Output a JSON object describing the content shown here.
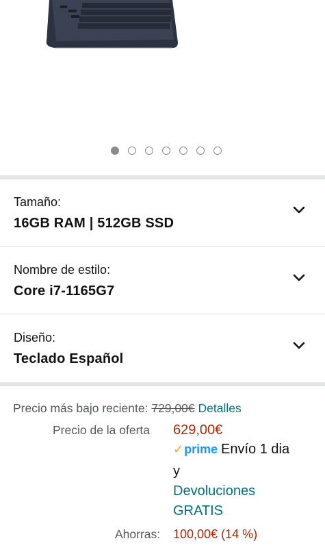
{
  "carousel": {
    "dot_count": 7,
    "active_index": 0
  },
  "variations": [
    {
      "label": "Tamaño:",
      "value": "16GB RAM | 512GB SSD"
    },
    {
      "label": "Nombre de estilo:",
      "value": "Core i7-1165G7"
    },
    {
      "label": "Diseño:",
      "value": "Teclado Español"
    }
  ],
  "pricing": {
    "recent_low_label": "Precio más bajo reciente:",
    "recent_low_value": "729,00€",
    "details_link": "Detalles",
    "offer_label": "Precio de la oferta",
    "offer_value": "629,00€",
    "prime_logo": "prime",
    "shipping_text": "Envío 1 dia",
    "and_text": "y",
    "returns_line1": "Devoluciones",
    "returns_line2": "GRATIS",
    "savings_label": "Ahorras:",
    "savings_value": "100,00€ (14 %)"
  },
  "colors": {
    "price_red": "#b12704",
    "link_teal": "#007185",
    "prime_blue": "#1a98ff",
    "prime_check": "#f7a51b"
  }
}
